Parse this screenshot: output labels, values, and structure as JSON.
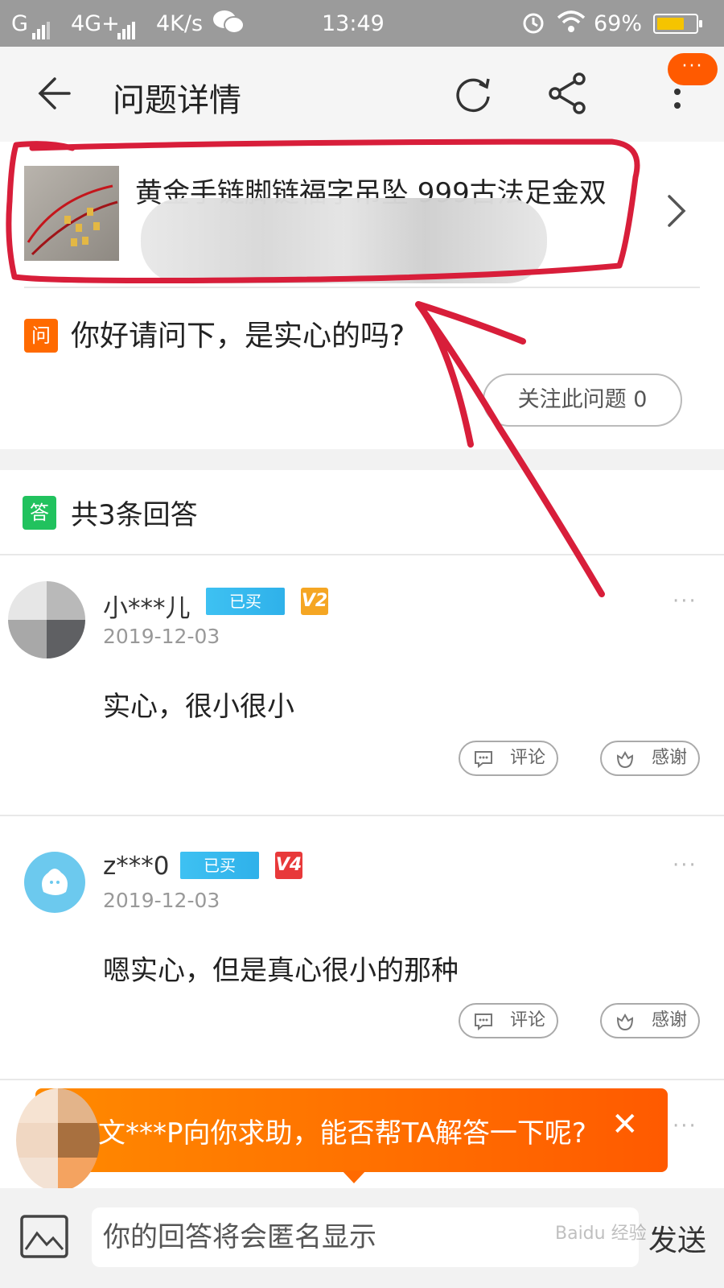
{
  "status_bar": {
    "carrier1": "G",
    "carrier2": "4G+",
    "speed": "4K/s",
    "time": "13:49",
    "battery": "69%"
  },
  "header": {
    "title": "问题详情",
    "more_badge": "···"
  },
  "product": {
    "title": "黄金手链脚链福字吊坠 999古法足金双"
  },
  "question": {
    "badge": "问",
    "text": "你好请问下，是实心的吗?",
    "follow_label": "关注此问题 0"
  },
  "answers": {
    "badge": "答",
    "count_label": "共3条回答",
    "items": [
      {
        "user": "小***儿",
        "bought": "已买",
        "level": "V2",
        "level_color": "#f5a623",
        "date": "2019-12-03",
        "content": "实心，很小很小",
        "comment_label": "评论",
        "thank_label": "感谢"
      },
      {
        "user": "z***0",
        "bought": "已买",
        "level": "V4",
        "level_color": "#e8393a",
        "date": "2019-12-03",
        "content": "嗯实心，但是真心很小的那种",
        "comment_label": "评论",
        "thank_label": "感谢"
      }
    ]
  },
  "help_banner": {
    "text": "文***P向你求助，能否帮TA解答一下呢?",
    "close": "✕"
  },
  "bottom_bar": {
    "placeholder": "你的回答将会匿名显示",
    "send_label": "发送",
    "watermark": "Baidu 经验"
  },
  "colors": {
    "accent_orange": "#ff5a00",
    "annotation_red": "#d81e3a",
    "answer_green": "#21c25e",
    "bought_blue": "#3ec1f2"
  }
}
